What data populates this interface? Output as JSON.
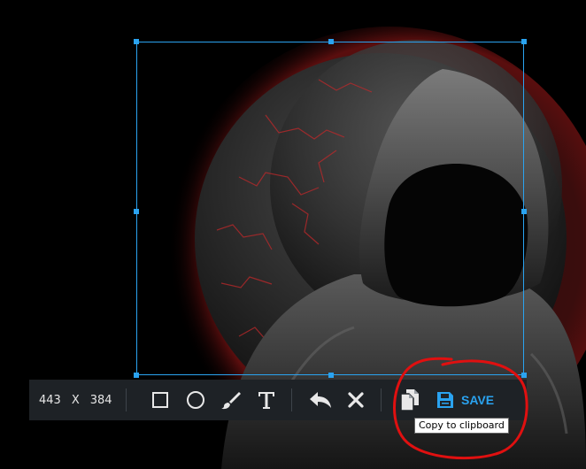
{
  "canvas": {
    "image_description_icon": "hooded-figure-image"
  },
  "toolbar": {
    "width_value": "443",
    "times_label": "X",
    "height_value": "384",
    "tools": [
      {
        "name": "rectangle-icon"
      },
      {
        "name": "ellipse-icon"
      },
      {
        "name": "brush-icon"
      },
      {
        "name": "text-icon"
      },
      {
        "name": "undo-icon"
      },
      {
        "name": "close-icon"
      },
      {
        "name": "copy-icon"
      },
      {
        "name": "save-icon"
      }
    ],
    "save_label": "SAVE",
    "tooltip": "Copy to clipboard"
  },
  "colors": {
    "accent": "#2aa3f0",
    "toolbar_bg": "#1e2226",
    "annotation_red": "#e01010"
  }
}
